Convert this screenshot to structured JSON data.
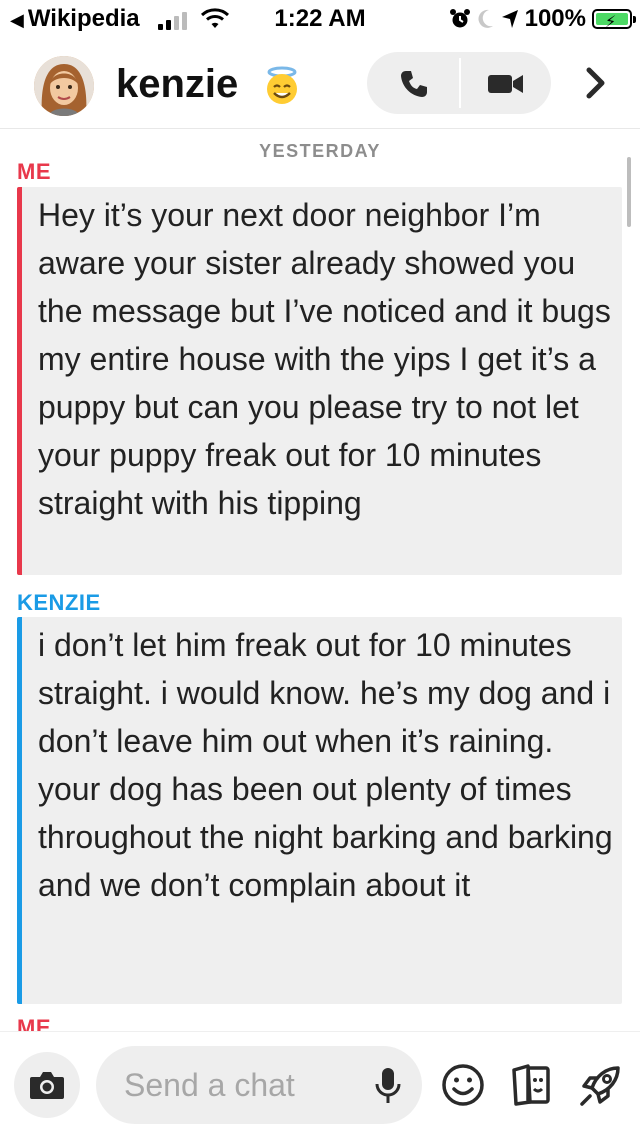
{
  "status_bar": {
    "back_app": "Wikipedia",
    "time": "1:22 AM",
    "battery": "100%"
  },
  "header": {
    "contact_name": "kenzie",
    "icons": [
      "bitmoji-avatar",
      "halo-smiley-emoji",
      "phone-icon",
      "video-camera-icon",
      "chevron-right-icon"
    ]
  },
  "chat": {
    "date_separator": "YESTERDAY",
    "messages": [
      {
        "sender": "ME",
        "color": "#e8384b",
        "text": "Hey it’s your next door neighbor I’m aware your sister already showed you the message but I’ve noticed and it bugs my entire house with the yips I get it’s a puppy but can you please try to not let your puppy freak out for 10 minutes straight with his tipping"
      },
      {
        "sender": "KENZIE",
        "color": "#1a9be6",
        "text": "i don’t let him freak out for 10 minutes straight. i would know. he’s my dog and i don’t leave him out when it’s raining.\nyour dog has been out plenty of times throughout the night barking and barking and we don’t complain about it"
      }
    ],
    "next_sender_partial": "ME"
  },
  "input_bar": {
    "placeholder": "Send a chat",
    "icons": [
      "camera-icon",
      "microphone-icon",
      "emoji-icon",
      "sticker-icon",
      "rocket-icon"
    ]
  },
  "colors": {
    "me_accent": "#e8384b",
    "kenzie_accent": "#1a9be6",
    "bubble_bg": "#efefef"
  }
}
